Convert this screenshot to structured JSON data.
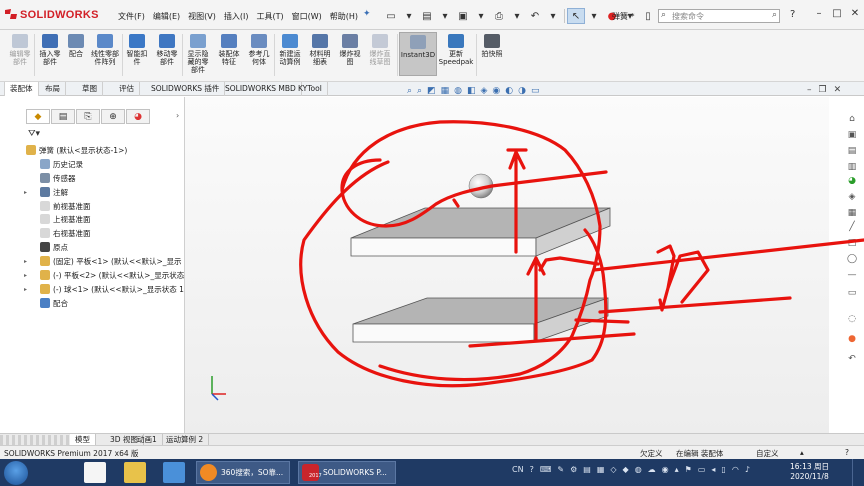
{
  "app": {
    "logo_text": "SOLIDWORKS",
    "document_name": "弹簧 *",
    "menu": [
      "文件(F)",
      "编辑(E)",
      "视图(V)",
      "插入(I)",
      "工具(T)",
      "窗口(W)",
      "帮助(H)"
    ],
    "search_placeholder": "搜索命令",
    "help_label": "?"
  },
  "ribbon": {
    "buttons": [
      {
        "label": "编辑零\n部件",
        "icon": "edit-component-icon",
        "disabled": true
      },
      {
        "label": "插入零\n部件",
        "icon": "insert-component-icon",
        "disabled": false
      },
      {
        "label": "配合",
        "icon": "mate-icon",
        "disabled": false
      },
      {
        "label": "线性零部\n件阵列",
        "icon": "linear-pattern-icon",
        "disabled": false
      },
      {
        "label": "智能扣\n件",
        "icon": "smart-fastener-icon",
        "disabled": false
      },
      {
        "label": "移动零\n部件",
        "icon": "move-component-icon",
        "disabled": false
      },
      {
        "label": "显示隐\n藏的零\n部件",
        "icon": "show-hidden-icon",
        "disabled": false
      },
      {
        "label": "装配体\n特征",
        "icon": "assembly-feature-icon",
        "disabled": false
      },
      {
        "label": "参考几\n何体",
        "icon": "reference-geometry-icon",
        "disabled": false
      },
      {
        "label": "新建运\n动算例",
        "icon": "motion-study-icon",
        "disabled": false
      },
      {
        "label": "材料明\n细表",
        "icon": "bom-icon",
        "disabled": false
      },
      {
        "label": "爆炸视\n图",
        "icon": "exploded-view-icon",
        "disabled": false
      },
      {
        "label": "爆炸直\n线草图",
        "icon": "explode-line-icon",
        "disabled": true
      },
      {
        "label": "Instant3D",
        "icon": "instant3d-icon",
        "disabled": false
      },
      {
        "label": "更新\nSpeedpak",
        "icon": "speedpak-icon",
        "disabled": false
      },
      {
        "label": "拍快照",
        "icon": "snapshot-icon",
        "disabled": false
      }
    ]
  },
  "tabs": [
    "装配体",
    "布局",
    "草图",
    "评估",
    "SOLIDWORKS 插件",
    "SOLIDWORKS MBD",
    "KYTool"
  ],
  "tree": {
    "root": "弹簧 (默认<显示状态-1>)",
    "items": [
      {
        "label": "历史记录",
        "icon": "history-icon"
      },
      {
        "label": "传感器",
        "icon": "sensor-icon"
      },
      {
        "label": "注解",
        "icon": "annotation-icon"
      },
      {
        "label": "前视基准面",
        "icon": "plane-icon"
      },
      {
        "label": "上视基准面",
        "icon": "plane-icon"
      },
      {
        "label": "右视基准面",
        "icon": "plane-icon"
      },
      {
        "label": "原点",
        "icon": "origin-icon"
      },
      {
        "label": "(固定) 平板<1> (默认<<默认>_显示",
        "icon": "part-icon"
      },
      {
        "label": "(-) 平板<2> (默认<<默认>_显示状态",
        "icon": "part-icon"
      },
      {
        "label": "(-) 球<1> (默认<<默认>_显示状态 1",
        "icon": "part-icon"
      },
      {
        "label": "配合",
        "icon": "mates-icon"
      }
    ]
  },
  "bottom_tabs": [
    "模型",
    "3D 视图",
    "动画1",
    "运动算例 2"
  ],
  "status": {
    "product": "SOLIDWORKS Premium 2017 x64 版",
    "state1": "欠定义",
    "state2": "在编辑 装配体",
    "state3": "自定义"
  },
  "taskbar": {
    "apps": [
      "360搜索，SO靠...",
      "SOLIDWORKS P..."
    ],
    "app_icon_labels": [
      "",
      "2017"
    ],
    "ime": "CN",
    "time": "16:13 周日",
    "date": "2020/11/8"
  },
  "colors": {
    "brand": "#d21f26",
    "annotation": "#e8130e",
    "taskbar": "#1f3a64"
  }
}
